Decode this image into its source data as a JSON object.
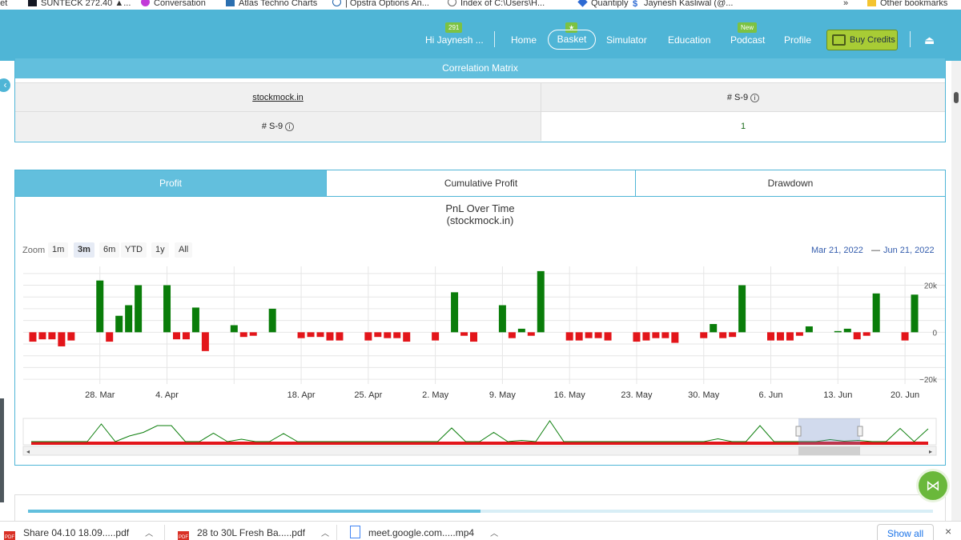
{
  "bookmarks": [
    {
      "label": "eet",
      "icon": "meet-icon"
    },
    {
      "label": "SUNTECK 272.40 ▲...",
      "icon": "tradingview-icon"
    },
    {
      "label": "Conversation",
      "icon": "chat-icon"
    },
    {
      "label": "Atlas Techno Charts",
      "icon": "atlas-icon"
    },
    {
      "label": "| Opstra Options An...",
      "icon": "opstra-icon"
    },
    {
      "label": "Index of C:\\Users\\H...",
      "icon": "globe-icon"
    },
    {
      "label": "Quantiply",
      "icon": "quantiply-icon"
    },
    {
      "label": "Jaynesh Kasliwal (@...",
      "icon": "dollar-icon"
    }
  ],
  "bookmarks_overflow": "»",
  "other_bookmarks": "Other bookmarks",
  "nav": {
    "greeting": "Hi Jaynesh ...",
    "greeting_badge": "291",
    "home": "Home",
    "basket": "Basket",
    "basket_badge": "★",
    "simulator": "Simulator",
    "education": "Education",
    "podcast": "Podcast",
    "podcast_badge": "New",
    "profile": "Profile",
    "buy_credits": "Buy Credits",
    "logout_icon": "⏏"
  },
  "correlation": {
    "title": "Correlation Matrix",
    "col_header": "stockmock.in",
    "row_header_top": "# S-9",
    "row_header_left": "# S-9",
    "info_symbol": "i",
    "value": "1"
  },
  "pnl": {
    "tabs": [
      "Profit",
      "Cumulative Profit",
      "Drawdown"
    ],
    "active_tab": 0,
    "zoom_label": "Zoom",
    "zoom_buttons": [
      "1m",
      "3m",
      "6m",
      "YTD",
      "1y",
      "All"
    ],
    "zoom_selected": 1,
    "range_from": "Mar 21, 2022",
    "range_sep": "—",
    "range_to": "Jun 21, 2022"
  },
  "chart_data": {
    "type": "bar",
    "title": "PnL Over Time",
    "subtitle": "(stockmock.in)",
    "x_tick_labels": [
      "28. Mar",
      "4. Apr",
      "18. Apr",
      "25. Apr",
      "2. May",
      "9. May",
      "16. May",
      "23. May",
      "30. May",
      "6. Jun",
      "13. Jun",
      "20. Jun"
    ],
    "y_tick_labels": [
      "20k",
      "0",
      "−20k"
    ],
    "ylim": [
      -22000,
      28000
    ],
    "grid": true,
    "colors": {
      "positive": "#0a7d0a",
      "negative": "#e3151a"
    },
    "x": [
      "2022-03-21",
      "2022-03-22",
      "2022-03-23",
      "2022-03-24",
      "2022-03-25",
      "2022-03-28",
      "2022-03-29",
      "2022-03-30",
      "2022-03-31",
      "2022-04-01",
      "2022-04-04",
      "2022-04-05",
      "2022-04-06",
      "2022-04-07",
      "2022-04-08",
      "2022-04-11",
      "2022-04-12",
      "2022-04-13",
      "2022-04-15",
      "2022-04-18",
      "2022-04-19",
      "2022-04-20",
      "2022-04-21",
      "2022-04-22",
      "2022-04-25",
      "2022-04-26",
      "2022-04-27",
      "2022-04-28",
      "2022-04-29",
      "2022-05-02",
      "2022-05-04",
      "2022-05-05",
      "2022-05-06",
      "2022-05-09",
      "2022-05-10",
      "2022-05-11",
      "2022-05-12",
      "2022-05-13",
      "2022-05-16",
      "2022-05-17",
      "2022-05-18",
      "2022-05-19",
      "2022-05-20",
      "2022-05-23",
      "2022-05-24",
      "2022-05-25",
      "2022-05-26",
      "2022-05-27",
      "2022-05-30",
      "2022-05-31",
      "2022-06-01",
      "2022-06-02",
      "2022-06-03",
      "2022-06-06",
      "2022-06-07",
      "2022-06-08",
      "2022-06-09",
      "2022-06-10",
      "2022-06-13",
      "2022-06-14",
      "2022-06-15",
      "2022-06-16",
      "2022-06-17",
      "2022-06-20",
      "2022-06-21"
    ],
    "values": [
      -4000,
      -3000,
      -3000,
      -6000,
      -3500,
      22000,
      -4000,
      7000,
      11500,
      20000,
      20000,
      -3000,
      -3000,
      10500,
      -8000,
      3000,
      -2000,
      -1500,
      10000,
      -2500,
      -2000,
      -2000,
      -3500,
      -3500,
      -3500,
      -2000,
      -2500,
      -2500,
      -4000,
      -3500,
      17000,
      -1500,
      -4000,
      11500,
      -2500,
      1500,
      -1500,
      26000,
      -3500,
      -3500,
      -2500,
      -2500,
      -3500,
      -4000,
      -3500,
      -2500,
      -2500,
      -4500,
      -2500,
      3500,
      -2500,
      -2000,
      20000,
      -3500,
      -3500,
      -3500,
      -1500,
      2500,
      500,
      1500,
      -3000,
      -1500,
      16500,
      -3500,
      16000
    ]
  },
  "downloads": [
    {
      "name": "Share 04.10 18.09.....pdf",
      "type": "pdf"
    },
    {
      "name": "28 to 30L Fresh Ba.....pdf",
      "type": "pdf"
    },
    {
      "name": "meet.google.com.....mp4",
      "type": "mp4"
    }
  ],
  "pdf_label": "PDF",
  "show_all": "Show all",
  "close_symbol": "×",
  "share_icon": "⋈",
  "left_handle_symbol": "‹"
}
